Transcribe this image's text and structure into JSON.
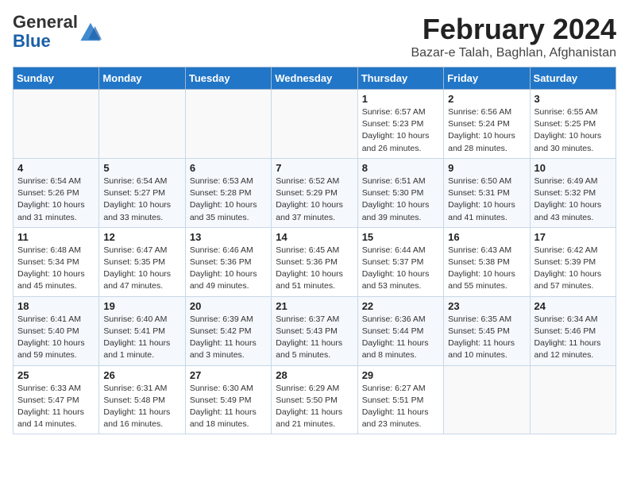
{
  "logo": {
    "general": "General",
    "blue": "Blue"
  },
  "title": "February 2024",
  "subtitle": "Bazar-e Talah, Baghlan, Afghanistan",
  "weekdays": [
    "Sunday",
    "Monday",
    "Tuesday",
    "Wednesday",
    "Thursday",
    "Friday",
    "Saturday"
  ],
  "weeks": [
    [
      {
        "day": "",
        "info": ""
      },
      {
        "day": "",
        "info": ""
      },
      {
        "day": "",
        "info": ""
      },
      {
        "day": "",
        "info": ""
      },
      {
        "day": "1",
        "info": "Sunrise: 6:57 AM\nSunset: 5:23 PM\nDaylight: 10 hours\nand 26 minutes."
      },
      {
        "day": "2",
        "info": "Sunrise: 6:56 AM\nSunset: 5:24 PM\nDaylight: 10 hours\nand 28 minutes."
      },
      {
        "day": "3",
        "info": "Sunrise: 6:55 AM\nSunset: 5:25 PM\nDaylight: 10 hours\nand 30 minutes."
      }
    ],
    [
      {
        "day": "4",
        "info": "Sunrise: 6:54 AM\nSunset: 5:26 PM\nDaylight: 10 hours\nand 31 minutes."
      },
      {
        "day": "5",
        "info": "Sunrise: 6:54 AM\nSunset: 5:27 PM\nDaylight: 10 hours\nand 33 minutes."
      },
      {
        "day": "6",
        "info": "Sunrise: 6:53 AM\nSunset: 5:28 PM\nDaylight: 10 hours\nand 35 minutes."
      },
      {
        "day": "7",
        "info": "Sunrise: 6:52 AM\nSunset: 5:29 PM\nDaylight: 10 hours\nand 37 minutes."
      },
      {
        "day": "8",
        "info": "Sunrise: 6:51 AM\nSunset: 5:30 PM\nDaylight: 10 hours\nand 39 minutes."
      },
      {
        "day": "9",
        "info": "Sunrise: 6:50 AM\nSunset: 5:31 PM\nDaylight: 10 hours\nand 41 minutes."
      },
      {
        "day": "10",
        "info": "Sunrise: 6:49 AM\nSunset: 5:32 PM\nDaylight: 10 hours\nand 43 minutes."
      }
    ],
    [
      {
        "day": "11",
        "info": "Sunrise: 6:48 AM\nSunset: 5:34 PM\nDaylight: 10 hours\nand 45 minutes."
      },
      {
        "day": "12",
        "info": "Sunrise: 6:47 AM\nSunset: 5:35 PM\nDaylight: 10 hours\nand 47 minutes."
      },
      {
        "day": "13",
        "info": "Sunrise: 6:46 AM\nSunset: 5:36 PM\nDaylight: 10 hours\nand 49 minutes."
      },
      {
        "day": "14",
        "info": "Sunrise: 6:45 AM\nSunset: 5:36 PM\nDaylight: 10 hours\nand 51 minutes."
      },
      {
        "day": "15",
        "info": "Sunrise: 6:44 AM\nSunset: 5:37 PM\nDaylight: 10 hours\nand 53 minutes."
      },
      {
        "day": "16",
        "info": "Sunrise: 6:43 AM\nSunset: 5:38 PM\nDaylight: 10 hours\nand 55 minutes."
      },
      {
        "day": "17",
        "info": "Sunrise: 6:42 AM\nSunset: 5:39 PM\nDaylight: 10 hours\nand 57 minutes."
      }
    ],
    [
      {
        "day": "18",
        "info": "Sunrise: 6:41 AM\nSunset: 5:40 PM\nDaylight: 10 hours\nand 59 minutes."
      },
      {
        "day": "19",
        "info": "Sunrise: 6:40 AM\nSunset: 5:41 PM\nDaylight: 11 hours\nand 1 minute."
      },
      {
        "day": "20",
        "info": "Sunrise: 6:39 AM\nSunset: 5:42 PM\nDaylight: 11 hours\nand 3 minutes."
      },
      {
        "day": "21",
        "info": "Sunrise: 6:37 AM\nSunset: 5:43 PM\nDaylight: 11 hours\nand 5 minutes."
      },
      {
        "day": "22",
        "info": "Sunrise: 6:36 AM\nSunset: 5:44 PM\nDaylight: 11 hours\nand 8 minutes."
      },
      {
        "day": "23",
        "info": "Sunrise: 6:35 AM\nSunset: 5:45 PM\nDaylight: 11 hours\nand 10 minutes."
      },
      {
        "day": "24",
        "info": "Sunrise: 6:34 AM\nSunset: 5:46 PM\nDaylight: 11 hours\nand 12 minutes."
      }
    ],
    [
      {
        "day": "25",
        "info": "Sunrise: 6:33 AM\nSunset: 5:47 PM\nDaylight: 11 hours\nand 14 minutes."
      },
      {
        "day": "26",
        "info": "Sunrise: 6:31 AM\nSunset: 5:48 PM\nDaylight: 11 hours\nand 16 minutes."
      },
      {
        "day": "27",
        "info": "Sunrise: 6:30 AM\nSunset: 5:49 PM\nDaylight: 11 hours\nand 18 minutes."
      },
      {
        "day": "28",
        "info": "Sunrise: 6:29 AM\nSunset: 5:50 PM\nDaylight: 11 hours\nand 21 minutes."
      },
      {
        "day": "29",
        "info": "Sunrise: 6:27 AM\nSunset: 5:51 PM\nDaylight: 11 hours\nand 23 minutes."
      },
      {
        "day": "",
        "info": ""
      },
      {
        "day": "",
        "info": ""
      }
    ]
  ]
}
